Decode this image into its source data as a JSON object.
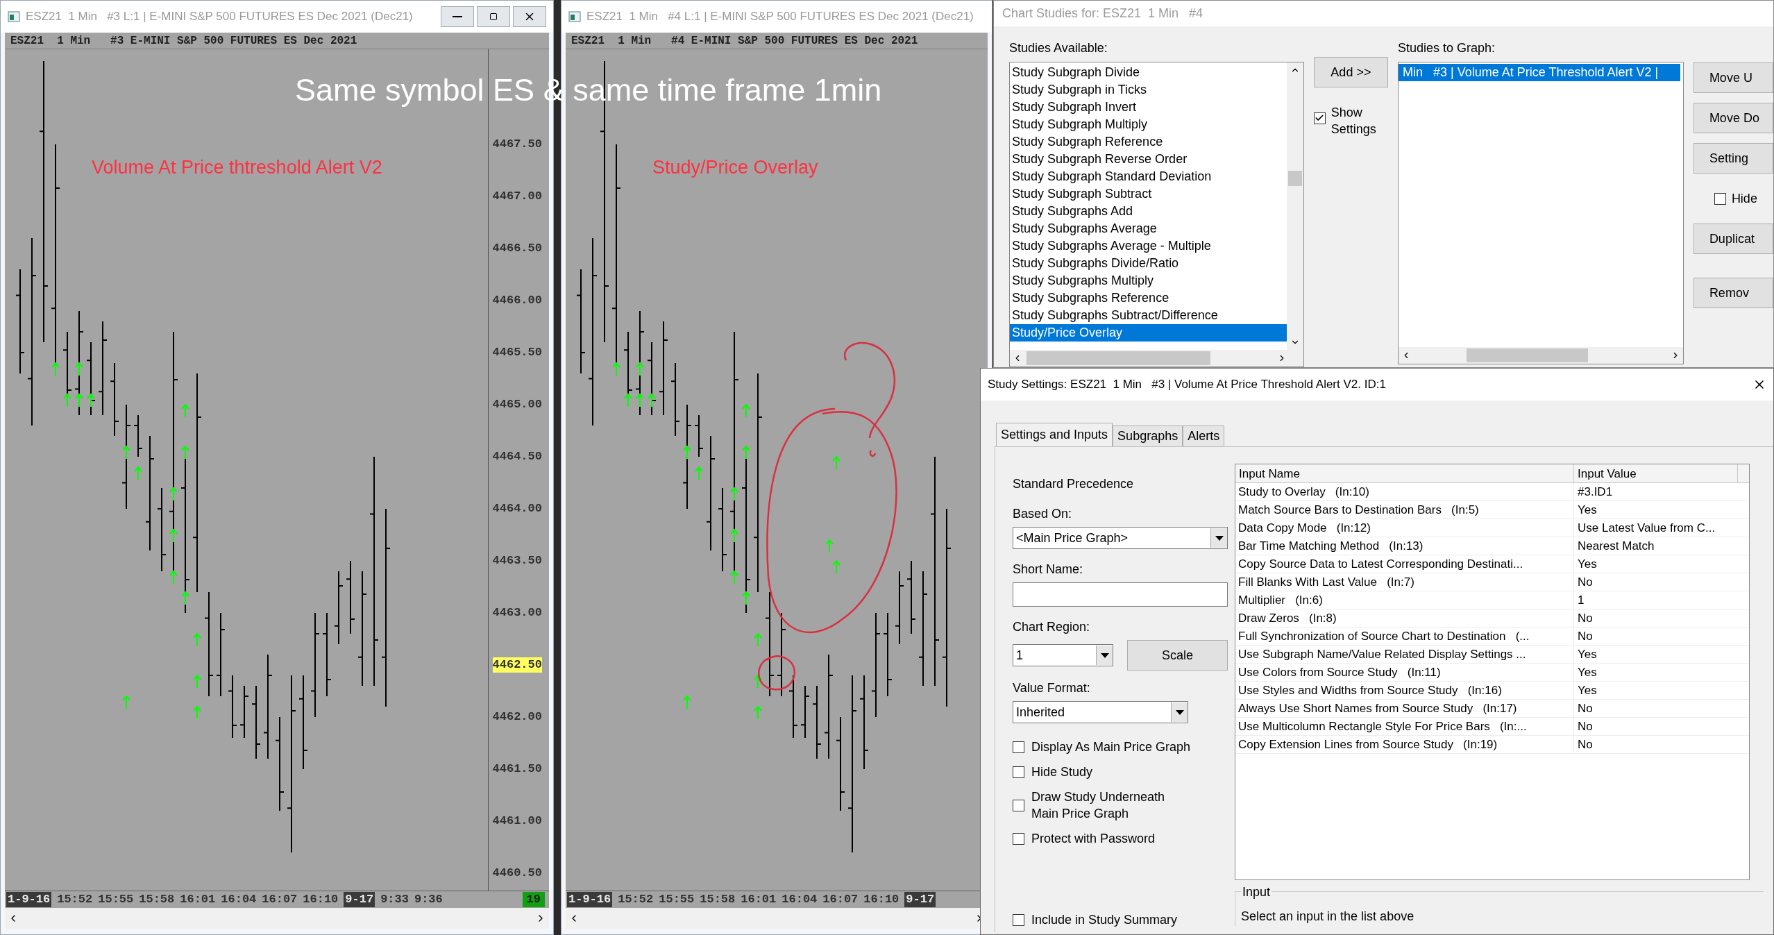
{
  "overlay_caption": "Same symbol ES & same time frame 1min",
  "chart_windows": [
    {
      "title": "ESZ21  1 Min   #3 L:1 | E-MINI S&P 500 FUTURES ES Dec 2021 (Dec21)",
      "window_buttons": true,
      "header": "ESZ21  1 Min   #3 E-MINI S&P 500 FUTURES ES Dec 2021",
      "annotation": "Volume At Price thtreshold Alert V2",
      "circled": false,
      "price_labels": [
        {
          "text": "4467.50",
          "highlighted": false
        },
        {
          "text": "4467.00",
          "highlighted": false
        },
        {
          "text": "4466.50",
          "highlighted": false
        },
        {
          "text": "4466.00",
          "highlighted": false
        },
        {
          "text": "4465.50",
          "highlighted": false
        },
        {
          "text": "4465.00",
          "highlighted": false
        },
        {
          "text": "4464.50",
          "highlighted": false
        },
        {
          "text": "4464.00",
          "highlighted": false
        },
        {
          "text": "4463.50",
          "highlighted": false
        },
        {
          "text": "4463.00",
          "highlighted": false
        },
        {
          "text": "4462.50",
          "highlighted": true
        },
        {
          "text": "4462.00",
          "highlighted": false
        },
        {
          "text": "4461.50",
          "highlighted": false
        },
        {
          "text": "4461.00",
          "highlighted": false
        },
        {
          "text": "4460.50",
          "highlighted": false
        }
      ],
      "time_labels": [
        {
          "text": "1-9-16",
          "kind": "date"
        },
        {
          "text": "15:52",
          "kind": "time"
        },
        {
          "text": "15:55",
          "kind": "time"
        },
        {
          "text": "15:58",
          "kind": "time"
        },
        {
          "text": "16:01",
          "kind": "time"
        },
        {
          "text": "16:04",
          "kind": "time"
        },
        {
          "text": "16:07",
          "kind": "time"
        },
        {
          "text": "16:10",
          "kind": "time"
        },
        {
          "text": "9-17",
          "kind": "date"
        },
        {
          "text": "9:33",
          "kind": "time"
        },
        {
          "text": "9:36",
          "kind": "time"
        },
        {
          "text": "19",
          "kind": "counter"
        }
      ]
    },
    {
      "title": "ESZ21  1 Min   #4 L:1 | E-MINI S&P 500 FUTURES ES Dec 2021 (Dec21)",
      "window_buttons": false,
      "header": "ESZ21  1 Min   #4 E-MINI S&P 500 FUTURES ES Dec 2021",
      "annotation": "Study/Price Overlay",
      "circled": true,
      "time_labels": [
        {
          "text": "1-9-16",
          "kind": "date"
        },
        {
          "text": "15:52",
          "kind": "time"
        },
        {
          "text": "15:55",
          "kind": "time"
        },
        {
          "text": "15:58",
          "kind": "time"
        },
        {
          "text": "16:01",
          "kind": "time"
        },
        {
          "text": "16:04",
          "kind": "time"
        },
        {
          "text": "16:07",
          "kind": "time"
        },
        {
          "text": "16:10",
          "kind": "time"
        },
        {
          "text": "9-17",
          "kind": "date"
        }
      ]
    }
  ],
  "chart_studies": {
    "title": "Chart Studies for: ESZ21  1 Min   #4",
    "available_label": "Studies Available:",
    "available": [
      {
        "label": "Study Subgraph Divide",
        "selected": false
      },
      {
        "label": "Study Subgraph in Ticks",
        "selected": false
      },
      {
        "label": "Study Subgraph Invert",
        "selected": false
      },
      {
        "label": "Study Subgraph Multiply",
        "selected": false
      },
      {
        "label": "Study Subgraph Reference",
        "selected": false
      },
      {
        "label": "Study Subgraph Reverse Order",
        "selected": false
      },
      {
        "label": "Study Subgraph Standard Deviation",
        "selected": false
      },
      {
        "label": "Study Subgraph Subtract",
        "selected": false
      },
      {
        "label": "Study Subgraphs Add",
        "selected": false
      },
      {
        "label": "Study Subgraphs Average",
        "selected": false
      },
      {
        "label": "Study Subgraphs Average - Multiple",
        "selected": false
      },
      {
        "label": "Study Subgraphs Divide/Ratio",
        "selected": false
      },
      {
        "label": "Study Subgraphs Multiply",
        "selected": false
      },
      {
        "label": "Study Subgraphs Reference",
        "selected": false
      },
      {
        "label": "Study Subgraphs Subtract/Difference",
        "selected": false
      },
      {
        "label": "Study/Price Overlay",
        "selected": true
      }
    ],
    "add_button": "Add >>",
    "show_settings": {
      "label": "Show Settings",
      "checked": true
    },
    "graph_label": "Studies to Graph:",
    "graph_items": [
      {
        "label": "Min   #3 | Volume At Price Threshold Alert V2 |",
        "selected": true
      }
    ],
    "side_items": [
      {
        "kind": "button",
        "label": "Move U"
      },
      {
        "kind": "button",
        "label": "Move Do"
      },
      {
        "kind": "button",
        "label": "Setting"
      },
      {
        "kind": "checkbox",
        "label": "Hide",
        "checked": false
      },
      {
        "kind": "button",
        "label": "Duplicat"
      },
      {
        "kind": "button",
        "label": "Remov"
      }
    ]
  },
  "study_settings": {
    "title": "Study Settings: ESZ21  1 Min   #3 | Volume At Price Threshold Alert V2. ID:1",
    "tabs": [
      {
        "label": "Settings and Inputs",
        "selected": true
      },
      {
        "label": "Subgraphs",
        "selected": false
      },
      {
        "label": "Alerts",
        "selected": false
      }
    ],
    "precedence": "Standard Precedence",
    "based_on": {
      "label": "Based On:",
      "value": "<Main Price Graph>"
    },
    "short_name": {
      "label": "Short Name:"
    },
    "chart_region": {
      "label": "Chart Region:",
      "value": "1"
    },
    "scale_button": "Scale",
    "value_format": {
      "label": "Value Format:",
      "value": "Inherited"
    },
    "options": [
      {
        "label": "Display As Main Price Graph",
        "checked": false
      },
      {
        "label": "Hide Study",
        "checked": false
      },
      {
        "label": "Draw Study Underneath Main Price Graph",
        "checked": false
      },
      {
        "label": "Protect with Password",
        "checked": false
      }
    ],
    "summary_option": {
      "label": "Include in Study Summary",
      "checked": false
    },
    "inputs_table": {
      "columns": [
        "Input Name",
        "Input Value"
      ],
      "rows": [
        {
          "name": "Study to Overlay   (In:10)",
          "value": "#3.ID1"
        },
        {
          "name": "Match Source Bars to Destination Bars   (In:5)",
          "value": "Yes"
        },
        {
          "name": "Data Copy Mode   (In:12)",
          "value": "Use Latest Value from C..."
        },
        {
          "name": "Bar Time Matching Method   (In:13)",
          "value": "Nearest Match"
        },
        {
          "name": "Copy Source Data to Latest Corresponding Destinati...",
          "value": "Yes"
        },
        {
          "name": "Fill Blanks With Last Value   (In:7)",
          "value": "No"
        },
        {
          "name": "Multiplier   (In:6)",
          "value": "1"
        },
        {
          "name": "Draw Zeros   (In:8)",
          "value": "No"
        },
        {
          "name": "Full Synchronization of Source Chart to Destination   (...",
          "value": "No"
        },
        {
          "name": "Use Subgraph Name/Value Related Display Settings ...",
          "value": "Yes"
        },
        {
          "name": "Use Colors from Source Study   (In:11)",
          "value": "Yes"
        },
        {
          "name": "Use Styles and Widths from Source Study   (In:16)",
          "value": "Yes"
        },
        {
          "name": "Always Use Short Names from Source Study   (In:17)",
          "value": "No"
        },
        {
          "name": "Use Multicolumn Rectangle Style For Price Bars   (In:...",
          "value": "No"
        },
        {
          "name": "Copy Extension Lines from Source Study   (In:19)",
          "value": "No"
        }
      ]
    },
    "input_group": {
      "label": "Input",
      "hint": "Select an input in the list above"
    }
  }
}
